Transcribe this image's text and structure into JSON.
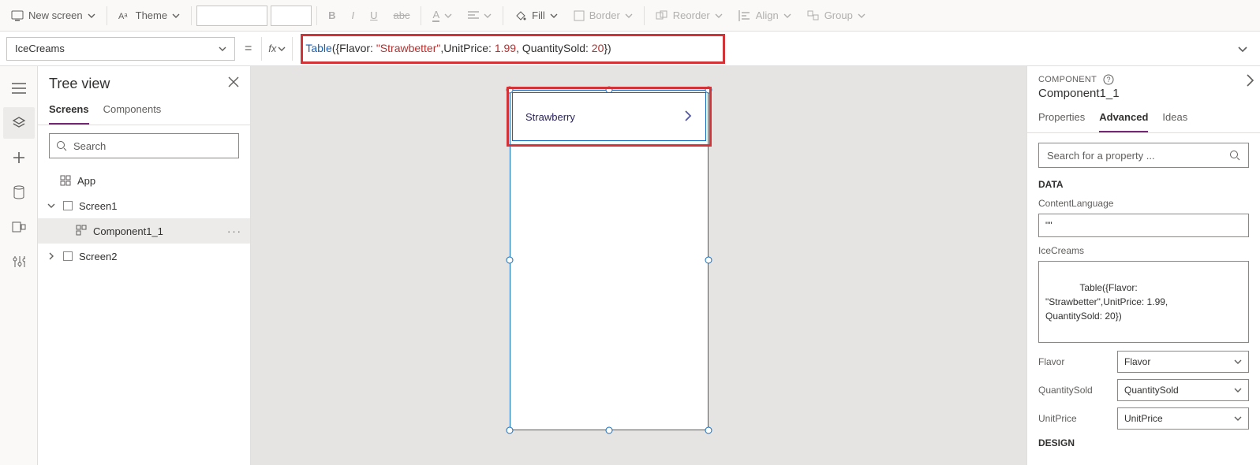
{
  "ribbon": {
    "new_screen": "New screen",
    "theme": "Theme",
    "bold": "B",
    "italic": "I",
    "underline": "U",
    "strike": "abc",
    "fontcolor": "A",
    "align": "",
    "fill": "Fill",
    "border": "Border",
    "reorder": "Reorder",
    "alignbtn": "Align",
    "group": "Group"
  },
  "formula": {
    "property": "IceCreams",
    "eq": "=",
    "fx": "fx",
    "fn": "Table",
    "body1": "({Flavor: ",
    "str": "\"Strawbetter\"",
    "body2": ",UnitPrice: ",
    "num1": "1.99",
    "body3": ", QuantitySold: ",
    "num2": "20",
    "body4": "})"
  },
  "tree": {
    "title": "Tree view",
    "tab_screens": "Screens",
    "tab_components": "Components",
    "search_ph": "Search",
    "app": "App",
    "screen1": "Screen1",
    "comp": "Component1_1",
    "screen2": "Screen2"
  },
  "canvas": {
    "flavor": "Strawberry"
  },
  "props": {
    "header": "COMPONENT",
    "title": "Component1_1",
    "tab_props": "Properties",
    "tab_adv": "Advanced",
    "tab_ideas": "Ideas",
    "search_ph": "Search for a property ...",
    "sect_data": "DATA",
    "content_lang_label": "ContentLanguage",
    "content_lang_val": "\"\"",
    "icecreams_label": "IceCreams",
    "icecreams_val": "Table({Flavor:\n\"Strawbetter\",UnitPrice: 1.99,\nQuantitySold: 20})",
    "flavor_k": "Flavor",
    "flavor_v": "Flavor",
    "qty_k": "QuantitySold",
    "qty_v": "QuantitySold",
    "price_k": "UnitPrice",
    "price_v": "UnitPrice",
    "sect_design": "DESIGN"
  }
}
